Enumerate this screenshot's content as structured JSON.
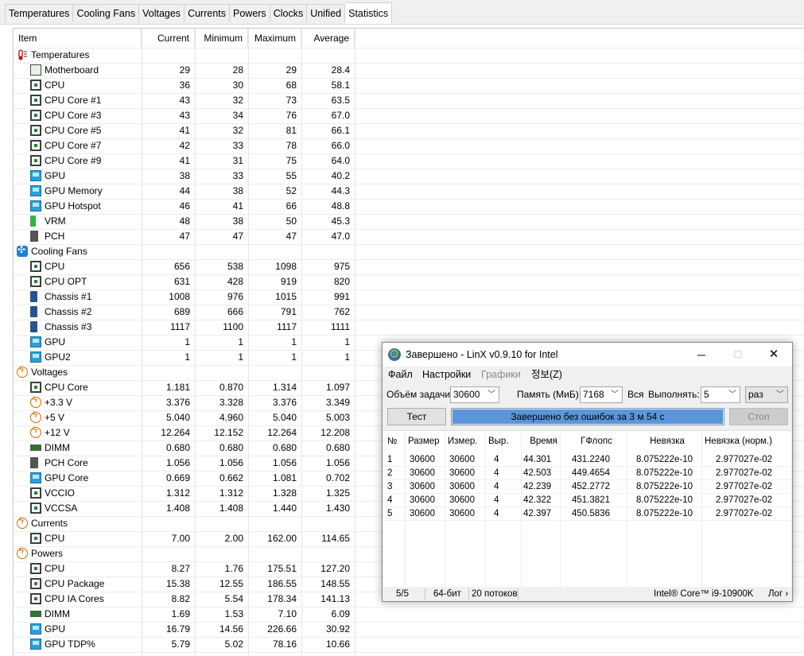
{
  "tabs": [
    "Temperatures",
    "Cooling Fans",
    "Voltages",
    "Currents",
    "Powers",
    "Clocks",
    "Unified",
    "Statistics"
  ],
  "active_tab": 7,
  "columns": {
    "item": "Item",
    "current": "Current",
    "minimum": "Minimum",
    "maximum": "Maximum",
    "average": "Average"
  },
  "rows": [
    {
      "type": "group",
      "icon": "thermometer-icon",
      "label": "Temperatures"
    },
    {
      "type": "item",
      "icon": "motherboard-icon",
      "label": "Motherboard",
      "cur": "29",
      "min": "28",
      "max": "29",
      "avg": "28.4"
    },
    {
      "type": "item",
      "icon": "chip-icon",
      "label": "CPU",
      "cur": "36",
      "min": "30",
      "max": "68",
      "avg": "58.1"
    },
    {
      "type": "item",
      "icon": "chip-icon",
      "label": "CPU Core #1",
      "cur": "43",
      "min": "32",
      "max": "73",
      "avg": "63.5"
    },
    {
      "type": "item",
      "icon": "chip-icon",
      "label": "CPU Core #3",
      "cur": "43",
      "min": "34",
      "max": "76",
      "avg": "67.0"
    },
    {
      "type": "item",
      "icon": "chip-icon",
      "label": "CPU Core #5",
      "cur": "41",
      "min": "32",
      "max": "81",
      "avg": "66.1"
    },
    {
      "type": "item",
      "icon": "chip-icon",
      "label": "CPU Core #7",
      "cur": "42",
      "min": "33",
      "max": "78",
      "avg": "66.0"
    },
    {
      "type": "item",
      "icon": "chip-icon",
      "label": "CPU Core #9",
      "cur": "41",
      "min": "31",
      "max": "75",
      "avg": "64.0"
    },
    {
      "type": "item",
      "icon": "gpu-icon",
      "label": "GPU",
      "cur": "38",
      "min": "33",
      "max": "55",
      "avg": "40.2"
    },
    {
      "type": "item",
      "icon": "gpu-icon",
      "label": "GPU Memory",
      "cur": "44",
      "min": "38",
      "max": "52",
      "avg": "44.3"
    },
    {
      "type": "item",
      "icon": "gpu-icon",
      "label": "GPU Hotspot",
      "cur": "46",
      "min": "41",
      "max": "66",
      "avg": "48.8"
    },
    {
      "type": "item",
      "icon": "vrm-icon",
      "label": "VRM",
      "cur": "48",
      "min": "38",
      "max": "50",
      "avg": "45.3"
    },
    {
      "type": "item",
      "icon": "pch-icon",
      "label": "PCH",
      "cur": "47",
      "min": "47",
      "max": "47",
      "avg": "47.0"
    },
    {
      "type": "group",
      "icon": "fan-icon",
      "label": "Cooling Fans"
    },
    {
      "type": "item",
      "icon": "chip-icon",
      "label": "CPU",
      "cur": "656",
      "min": "538",
      "max": "1098",
      "avg": "975"
    },
    {
      "type": "item",
      "icon": "chip-icon",
      "label": "CPU OPT",
      "cur": "631",
      "min": "428",
      "max": "919",
      "avg": "820"
    },
    {
      "type": "item",
      "icon": "chassis-icon",
      "label": "Chassis #1",
      "cur": "1008",
      "min": "976",
      "max": "1015",
      "avg": "991"
    },
    {
      "type": "item",
      "icon": "chassis-icon",
      "label": "Chassis #2",
      "cur": "689",
      "min": "666",
      "max": "791",
      "avg": "762"
    },
    {
      "type": "item",
      "icon": "chassis-icon",
      "label": "Chassis #3",
      "cur": "1117",
      "min": "1100",
      "max": "1117",
      "avg": "1111"
    },
    {
      "type": "item",
      "icon": "gpu-icon",
      "label": "GPU",
      "cur": "1",
      "min": "1",
      "max": "1",
      "avg": "1"
    },
    {
      "type": "item",
      "icon": "gpu-icon",
      "label": "GPU2",
      "cur": "1",
      "min": "1",
      "max": "1",
      "avg": "1"
    },
    {
      "type": "group",
      "icon": "voltage-icon",
      "label": "Voltages"
    },
    {
      "type": "item",
      "icon": "chip-icon",
      "label": "CPU Core",
      "cur": "1.181",
      "min": "0.870",
      "max": "1.314",
      "avg": "1.097"
    },
    {
      "type": "item",
      "icon": "voltage-icon",
      "label": "+3.3 V",
      "cur": "3.376",
      "min": "3.328",
      "max": "3.376",
      "avg": "3.349"
    },
    {
      "type": "item",
      "icon": "voltage-icon",
      "label": "+5 V",
      "cur": "5.040",
      "min": "4.960",
      "max": "5.040",
      "avg": "5.003"
    },
    {
      "type": "item",
      "icon": "voltage-icon",
      "label": "+12 V",
      "cur": "12.264",
      "min": "12.152",
      "max": "12.264",
      "avg": "12.208"
    },
    {
      "type": "item",
      "icon": "dimm-icon",
      "label": "DIMM",
      "cur": "0.680",
      "min": "0.680",
      "max": "0.680",
      "avg": "0.680"
    },
    {
      "type": "item",
      "icon": "pch-icon",
      "label": "PCH Core",
      "cur": "1.056",
      "min": "1.056",
      "max": "1.056",
      "avg": "1.056"
    },
    {
      "type": "item",
      "icon": "gpu-icon",
      "label": "GPU Core",
      "cur": "0.669",
      "min": "0.662",
      "max": "1.081",
      "avg": "0.702"
    },
    {
      "type": "item",
      "icon": "chip-icon",
      "label": "VCCIO",
      "cur": "1.312",
      "min": "1.312",
      "max": "1.328",
      "avg": "1.325"
    },
    {
      "type": "item",
      "icon": "chip-icon",
      "label": "VCCSA",
      "cur": "1.408",
      "min": "1.408",
      "max": "1.440",
      "avg": "1.430"
    },
    {
      "type": "group",
      "icon": "current-icon",
      "label": "Currents"
    },
    {
      "type": "item",
      "icon": "chip-icon",
      "label": "CPU",
      "cur": "7.00",
      "min": "2.00",
      "max": "162.00",
      "avg": "114.65"
    },
    {
      "type": "group",
      "icon": "power-icon",
      "label": "Powers"
    },
    {
      "type": "item",
      "icon": "chip-icon",
      "label": "CPU",
      "cur": "8.27",
      "min": "1.76",
      "max": "175.51",
      "avg": "127.20"
    },
    {
      "type": "item",
      "icon": "chip-icon",
      "label": "CPU Package",
      "cur": "15.38",
      "min": "12.55",
      "max": "186.55",
      "avg": "148.55"
    },
    {
      "type": "item",
      "icon": "chip-icon",
      "label": "CPU IA Cores",
      "cur": "8.82",
      "min": "5.54",
      "max": "178.34",
      "avg": "141.13"
    },
    {
      "type": "item",
      "icon": "dimm-icon",
      "label": "DIMM",
      "cur": "1.69",
      "min": "1.53",
      "max": "7.10",
      "avg": "6.09"
    },
    {
      "type": "item",
      "icon": "gpu-icon",
      "label": "GPU",
      "cur": "16.79",
      "min": "14.56",
      "max": "226.66",
      "avg": "30.92"
    },
    {
      "type": "item",
      "icon": "gpu-icon",
      "label": "GPU TDP%",
      "cur": "5.79",
      "min": "5.02",
      "max": "78.16",
      "avg": "10.66"
    }
  ],
  "linx": {
    "title": "Завершено - LinX v0.9.10 for Intel",
    "window_controls": {
      "minimize": "─",
      "maximize": "☐",
      "close": "✕"
    },
    "menu": [
      "Файл",
      "Настройки",
      "Графики",
      "정보(Z)"
    ],
    "problem_size_label": "Объём задачи:",
    "problem_size_value": "30600",
    "memory_label": "Память (МиБ):",
    "memory_value": "7168",
    "all_label": "Вся",
    "run_label": "Выполнять:",
    "run_value": "5",
    "times_value": "раз",
    "test_button": "Тест",
    "progress_text": "Завершено без ошибок за 3 м 54 с",
    "progress": 1.0,
    "stop_button": "Стоп",
    "columns": [
      "№",
      "Размер",
      "Измер.",
      "Выр.",
      "Время",
      "ГФлопс",
      "Невязка",
      "Невязка (норм.)"
    ],
    "results": [
      [
        "1",
        "30600",
        "30600",
        "4",
        "44.301",
        "431.2240",
        "8.075222e-10",
        "2.977027e-02"
      ],
      [
        "2",
        "30600",
        "30600",
        "4",
        "42.503",
        "449.4654",
        "8.075222e-10",
        "2.977027e-02"
      ],
      [
        "3",
        "30600",
        "30600",
        "4",
        "42.239",
        "452.2772",
        "8.075222e-10",
        "2.977027e-02"
      ],
      [
        "4",
        "30600",
        "30600",
        "4",
        "42.322",
        "451.3821",
        "8.075222e-10",
        "2.977027e-02"
      ],
      [
        "5",
        "30600",
        "30600",
        "4",
        "42.397",
        "450.5836",
        "8.075222e-10",
        "2.977027e-02"
      ]
    ],
    "status": {
      "runs": "5/5",
      "bits": "64-бит",
      "threads": "20 потоков",
      "cpu": "Intel® Core™ i9-10900K",
      "log": "Лог ›"
    }
  }
}
